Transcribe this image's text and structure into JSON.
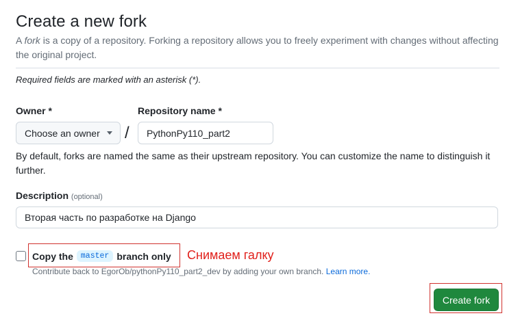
{
  "page": {
    "title": "Create a new fork",
    "subtitle_prefix": "A ",
    "subtitle_em": "fork",
    "subtitle_rest": " is a copy of a repository. Forking a repository allows you to freely experiment with changes without affecting the original project.",
    "required_note": "Required fields are marked with an asterisk (*)."
  },
  "owner": {
    "label": "Owner *",
    "selected": "Choose an owner",
    "caret_icon": "chevron-down-icon"
  },
  "separator": "/",
  "repository": {
    "label": "Repository name *",
    "value": "PythonPy110_part2",
    "note": "By default, forks are named the same as their upstream repository. You can customize the name to distinguish it further."
  },
  "description": {
    "label": "Description",
    "optional": "(optional)",
    "value": "Вторая часть по разработке на Django"
  },
  "copy_branch": {
    "checked": false,
    "label_before": "Copy the",
    "branch": "master",
    "label_after": "branch only",
    "note_text": "Contribute back to EgorOb/pythonPy110_part2_dev by adding your own branch.",
    "learn_more": "Learn more."
  },
  "annotation": {
    "text": "Снимаем галку",
    "color": "#e0201b"
  },
  "actions": {
    "create_fork": "Create fork"
  },
  "colors": {
    "primary_button": "#1f883d",
    "link": "#0969da",
    "highlight_border": "#d0312d"
  }
}
